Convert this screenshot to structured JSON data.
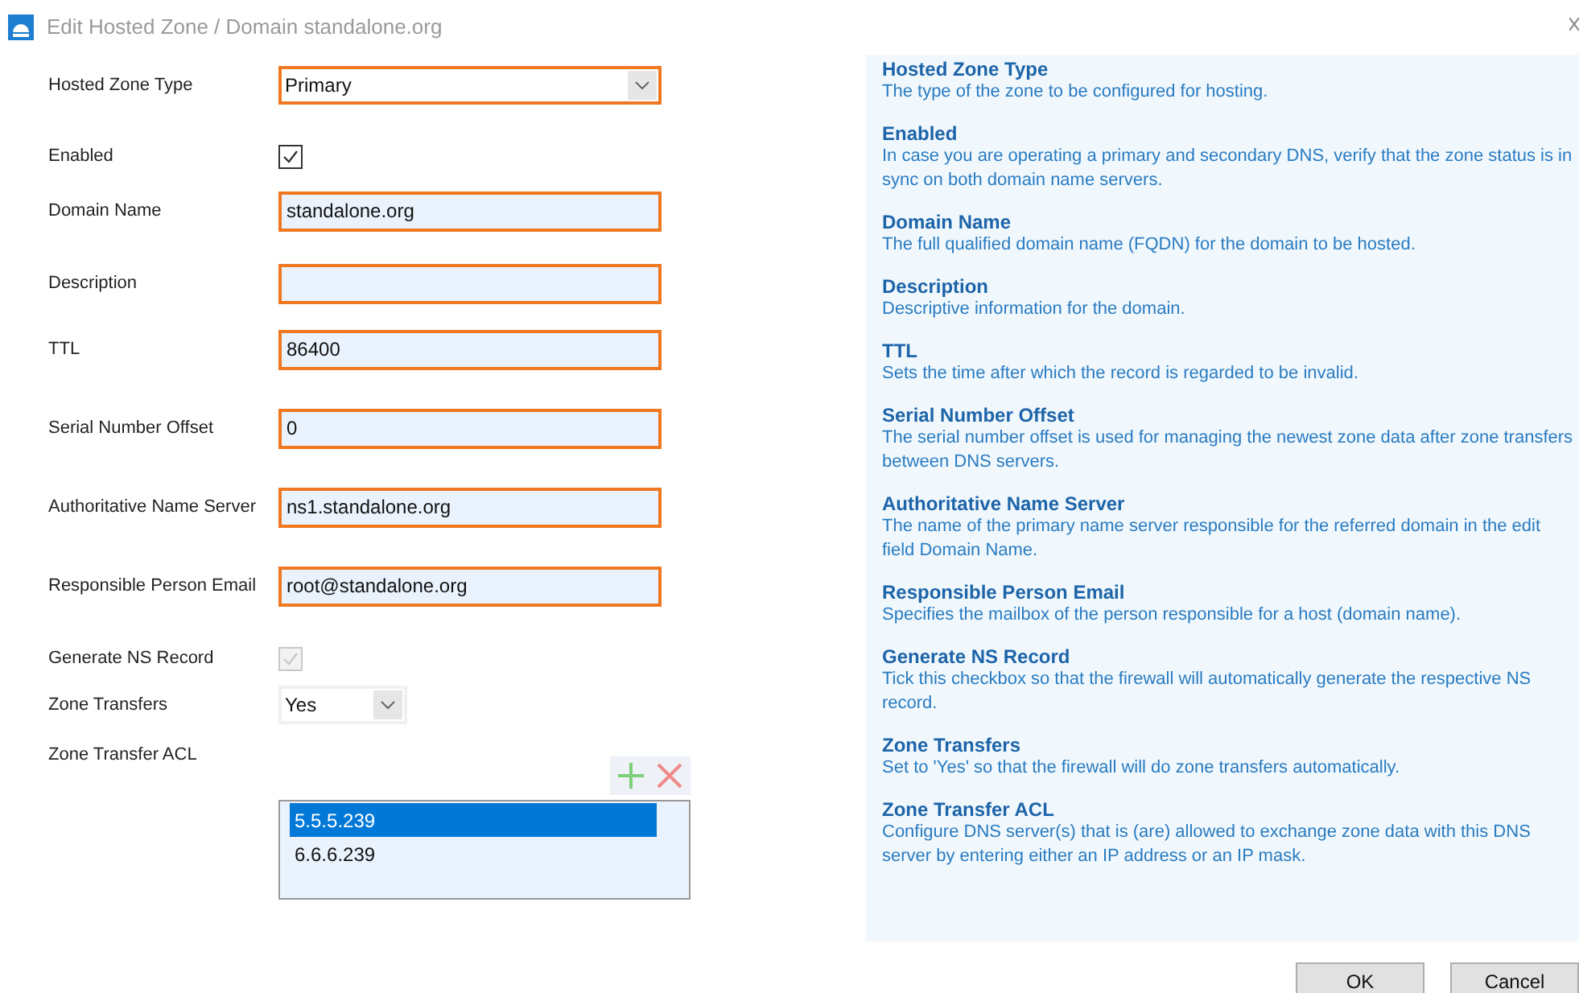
{
  "window": {
    "title": "Edit Hosted Zone / Domain standalone.org"
  },
  "form": [
    {
      "kind": "select",
      "label": "Hosted Zone Type",
      "value": "Primary",
      "highlighted": true
    },
    {
      "kind": "checkbox",
      "label": "Enabled",
      "checked": true,
      "disabled": false
    },
    {
      "kind": "text",
      "label": "Domain Name",
      "value": "standalone.org",
      "highlighted": true
    },
    {
      "kind": "text",
      "label": "Description",
      "highlighted": true
    },
    {
      "kind": "text",
      "label": "TTL",
      "value": "86400",
      "highlighted": true
    },
    {
      "kind": "text",
      "label": "Serial Number Offset",
      "value": "0",
      "highlighted": true
    },
    {
      "kind": "text",
      "label": "Authoritative Name Server",
      "value": "ns1.standalone.org",
      "highlighted": true
    },
    {
      "kind": "text",
      "label": "Responsible Person Email",
      "value": "root@standalone.org",
      "highlighted": true
    },
    {
      "kind": "checkbox",
      "label": "Generate NS Record",
      "checked": true,
      "disabled": true
    },
    {
      "kind": "select",
      "label": "Zone Transfers",
      "value": "Yes",
      "highlighted": false
    },
    {
      "kind": "list",
      "label": "Zone Transfer ACL",
      "items": [
        {
          "text": "5.5.5.239",
          "selected": true
        },
        {
          "text": "6.6.6.239",
          "selected": false
        }
      ]
    }
  ],
  "help": [
    {
      "title": "Hosted Zone Type",
      "text": "The type of the zone to be configured for hosting."
    },
    {
      "title": "Enabled",
      "text": "In case you are operating a primary and secondary DNS, verify that the zone status is in sync on both domain name servers."
    },
    {
      "title": "Domain Name",
      "text": "The full qualified domain name (FQDN) for the domain to be hosted."
    },
    {
      "title": "Description",
      "text": "Descriptive information for the domain."
    },
    {
      "title": "TTL",
      "text": "Sets the time after which the record is regarded to be invalid."
    },
    {
      "title": "Serial Number Offset",
      "text": "The serial number offset is used for managing the newest zone data after zone transfers between DNS servers."
    },
    {
      "title": "Authoritative Name Server",
      "text": "The name of the primary name server responsible for the referred domain in the edit field Domain Name."
    },
    {
      "title": "Responsible Person Email",
      "text": "Specifies the mailbox of the person responsible for a host (domain name)."
    },
    {
      "title": "Generate NS Record",
      "text": "Tick this checkbox so that the firewall will automatically generate the respective NS record."
    },
    {
      "title": "Zone Transfers",
      "text": "Set to 'Yes' so that the firewall will do zone transfers automatically."
    },
    {
      "title": "Zone Transfer ACL",
      "text": "Configure DNS server(s) that is (are) allowed to exchange zone data with this DNS server by entering either an IP address or an IP mask."
    }
  ],
  "buttons": [
    "OK",
    "Cancel"
  ]
}
